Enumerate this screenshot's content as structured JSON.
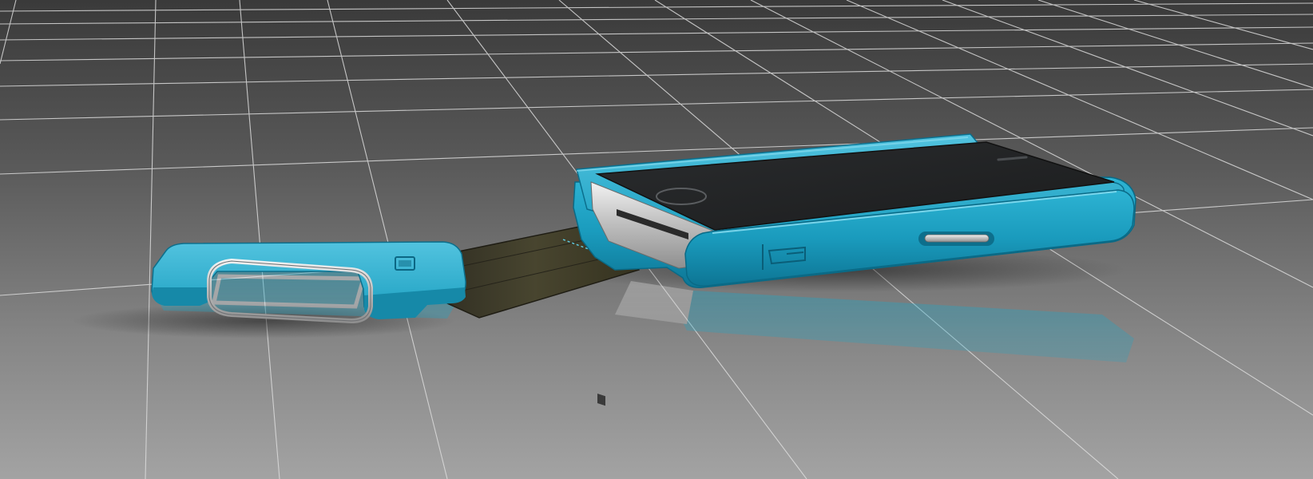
{
  "scene": {
    "colors": {
      "floor_far": "#3f3f3f",
      "floor_mid": "#6b6b6b",
      "floor_near": "#9c9c9c",
      "grid_line": "#d9d9d9",
      "case_teal": "#1fa6c6",
      "case_teal_dark": "#0f7fa0",
      "case_teal_light": "#5ec9e3",
      "phone_glass": "#222426",
      "phone_steel": "#c9c9c9",
      "strap_fabric": "#3d3a2c",
      "strap_stitch": "#5fd0e8",
      "carabiner_gate": "#e4e8ec"
    },
    "objects": {
      "ground": "ground-plane",
      "grid": "perspective-grid",
      "phone_case": "teal-phone-case",
      "phone": "smartphone",
      "strap": "webbing-strap",
      "carabiner": "carabiner-clip"
    }
  }
}
